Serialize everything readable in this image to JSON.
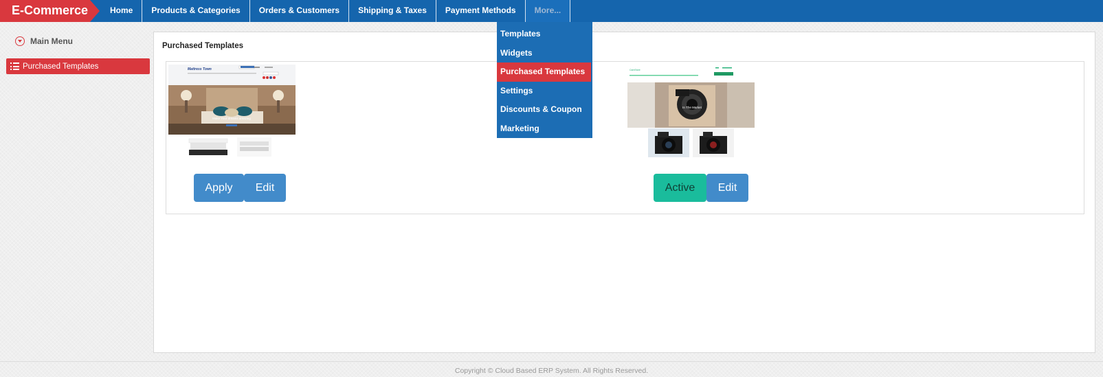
{
  "app": {
    "brand": "E-Commerce"
  },
  "nav": {
    "items": [
      {
        "label": "Home"
      },
      {
        "label": "Products & Categories"
      },
      {
        "label": "Orders & Customers"
      },
      {
        "label": "Shipping & Taxes"
      },
      {
        "label": "Payment Methods"
      },
      {
        "label": "More..."
      }
    ]
  },
  "dropdown": {
    "items": [
      {
        "label": "Templates"
      },
      {
        "label": "Widgets"
      },
      {
        "label": "Purchased Templates",
        "active": true
      },
      {
        "label": "Settings"
      },
      {
        "label": "Discounts & Coupon"
      },
      {
        "label": "Marketing"
      }
    ]
  },
  "sidebar": {
    "main_menu": "Main Menu",
    "active_item": "Purchased Templates"
  },
  "content": {
    "title": "Purchased Templates",
    "templates": [
      {
        "preview_logo": "Mattress Town",
        "preview_caption": "Make Your dreams amazing",
        "buttons": {
          "primary": "Apply",
          "secondary": "Edit"
        }
      },
      {
        "preview_logo": "CamStore",
        "preview_caption": "In The Market",
        "buttons": {
          "primary": "Active",
          "secondary": "Edit"
        }
      }
    ]
  },
  "footer": {
    "copyright": "Copyright © Cloud Based ERP System. All Rights Reserved."
  },
  "colors": {
    "nav_blue": "#1565ad",
    "brand_red": "#d9383e",
    "button_blue": "#428bca",
    "button_green": "#1abc9c"
  }
}
